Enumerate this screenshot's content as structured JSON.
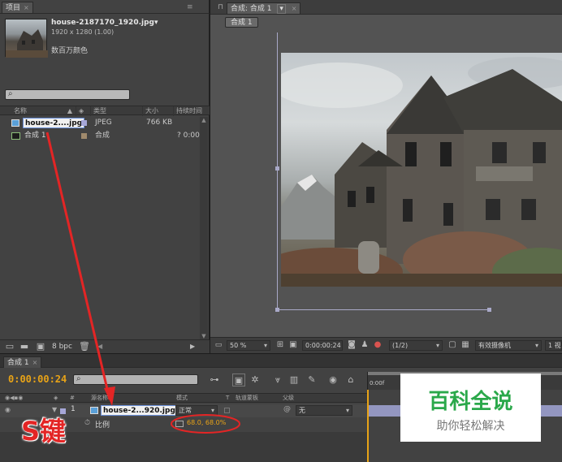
{
  "project_panel": {
    "tab_label": "项目",
    "preview": {
      "filename": "house-2187170_1920.jpg▾",
      "dimensions": "1920 x 1280 (1.00)",
      "color_mode": "数百万颜色"
    },
    "search_placeholder": "",
    "columns": {
      "name": "名称",
      "type": "类型",
      "size": "大小",
      "duration": "持续时间"
    },
    "items": [
      {
        "name": "house-2....jpg",
        "type": "JPEG",
        "size": "766 KB",
        "duration": ""
      },
      {
        "name": "合成 1",
        "type": "合成",
        "size": "",
        "duration": "? 0:00"
      }
    ],
    "bpc_label": "8 bpc"
  },
  "composition_panel": {
    "tab_label": "合成: 合成 1",
    "sub_tab": "合成 1",
    "zoom": "50 %",
    "timecode": "0:00:00:24",
    "resolution": "(1/2)",
    "camera": "有效摄像机",
    "views": "1 视"
  },
  "timeline_panel": {
    "tab_label": "合成 1",
    "timecode": "0:00:00:24",
    "ruler_start": "0:00f",
    "col_source": "源名称",
    "col_mode": "模式",
    "col_t": "T",
    "col_trkmat": "轨道蒙板",
    "col_parent": "父级",
    "layer": {
      "index": "1",
      "name": "house-2...920.jpg",
      "mode": "正常",
      "parent": "无"
    },
    "property": {
      "name": "比例",
      "value": "68.0, 68.0%"
    }
  },
  "annotation": {
    "key_label": "S键"
  },
  "watermark": {
    "title": "百科全说",
    "subtitle": "助你轻松解决"
  },
  "colors": {
    "accent_orange": "#e8a317",
    "annotation_red": "#e32525",
    "timecode_yellow": "#e8a317"
  }
}
